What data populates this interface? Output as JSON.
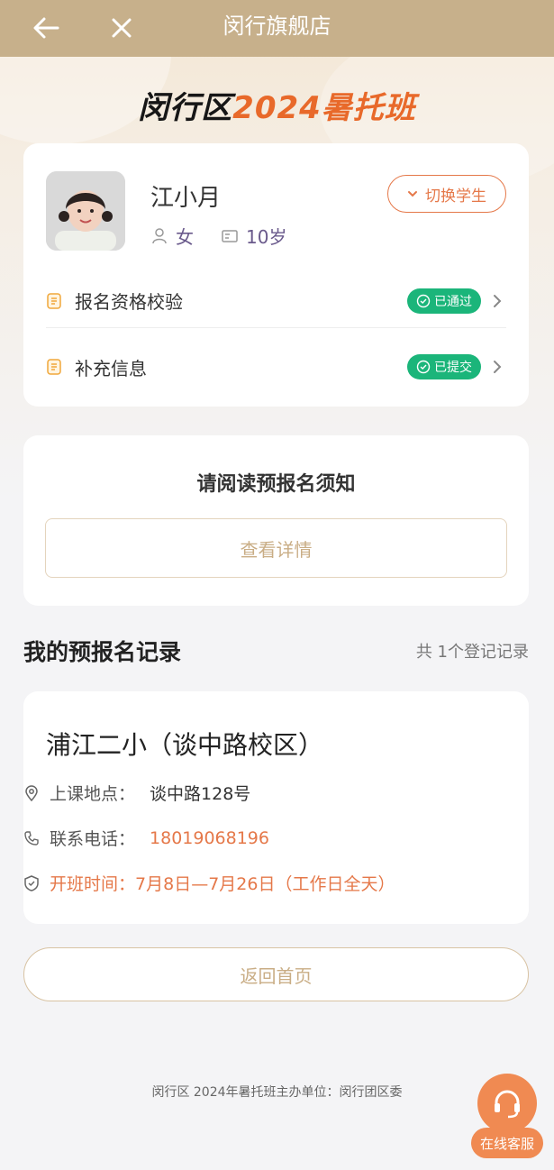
{
  "topbar": {
    "title": "闵行旗舰店"
  },
  "banner": {
    "title_prefix": "闵行区",
    "title_suffix": "2024暑托班"
  },
  "student": {
    "name": "江小月",
    "gender": "女",
    "age": "10岁",
    "switch_label": "切换学生",
    "rows": [
      {
        "label": "报名资格校验",
        "badge": "已通过"
      },
      {
        "label": "补充信息",
        "badge": "已提交"
      }
    ]
  },
  "notice": {
    "title": "请阅读预报名须知",
    "detail_label": "查看详情"
  },
  "records": {
    "title": "我的预报名记录",
    "count_text": "共 1个登记记录",
    "school": "浦江二小（谈中路校区）",
    "address_label": "上课地点：",
    "address": "谈中路128号",
    "phone_label": "联系电话：",
    "phone": "18019068196",
    "time_label": "开班时间：",
    "time": "7月8日—7月26日（工作日全天）"
  },
  "home_button": "返回首页",
  "footer": "闵行区 2024年暑托班主办单位：闵行团区委",
  "service_label": "在线客服",
  "colors": {
    "brand": "#c7b08b",
    "accent": "#e57849",
    "success": "#1bb57a"
  }
}
